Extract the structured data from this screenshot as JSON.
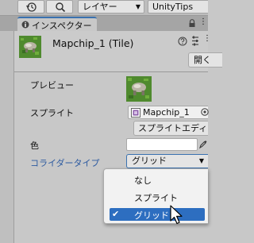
{
  "toolbar": {
    "layer_dropdown": "レイヤー",
    "layout_dropdown": "UnityTips"
  },
  "tab": {
    "label": "インスペクター"
  },
  "header": {
    "title": "Mapchip_1 (Tile)",
    "open_button": "開く"
  },
  "fields": {
    "preview_label": "プレビュー",
    "sprite_label": "スプライト",
    "sprite_value": "Mapchip_1",
    "sprite_editor_button": "スプライトエディター",
    "color_label": "色",
    "collider_type_label": "コライダータイプ",
    "collider_type_value": "グリッド"
  },
  "dropdown": {
    "options": [
      {
        "label": "なし",
        "selected": false
      },
      {
        "label": "スプライト",
        "selected": false
      },
      {
        "label": "グリッド",
        "selected": true
      }
    ],
    "selected_color": "#2d6ec0"
  },
  "colors": {
    "accent": "#3a72b0",
    "panel_bg": "#c8c8c8",
    "collider_label": "#2c5aa0"
  }
}
